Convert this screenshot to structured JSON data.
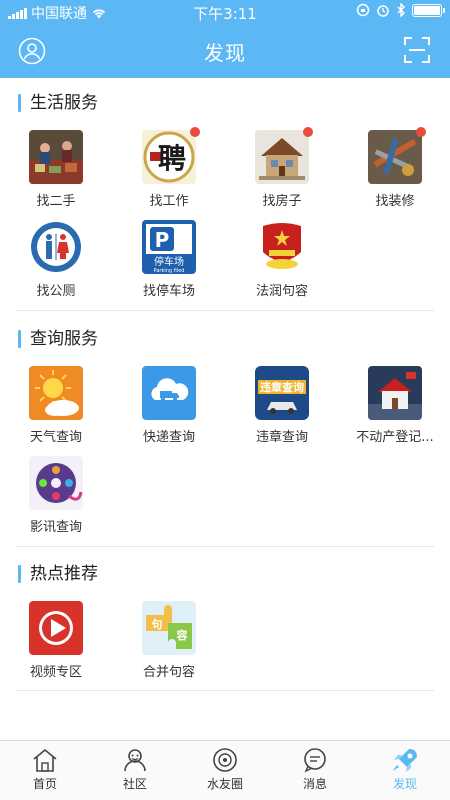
{
  "status_bar": {
    "carrier": "中国联通",
    "time": "下午3:11"
  },
  "nav": {
    "title": "发现"
  },
  "sections": [
    {
      "title": "生活服务",
      "items": [
        {
          "label": "找二手",
          "badge": false
        },
        {
          "label": "找工作",
          "badge": true
        },
        {
          "label": "找房子",
          "badge": true
        },
        {
          "label": "找装修",
          "badge": true
        },
        {
          "label": "找公厕",
          "badge": false
        },
        {
          "label": "找停车场",
          "badge": false
        },
        {
          "label": "法润句容",
          "badge": false
        }
      ]
    },
    {
      "title": "查询服务",
      "items": [
        {
          "label": "天气查询"
        },
        {
          "label": "快递查询"
        },
        {
          "label": "违章查询"
        },
        {
          "label": "不动产登记..."
        },
        {
          "label": "影讯查询"
        }
      ]
    },
    {
      "title": "热点推荐",
      "items": [
        {
          "label": "视频专区"
        },
        {
          "label": "合并句容"
        }
      ]
    }
  ],
  "icon_text": {
    "job": "聘",
    "parking_sign": "停车场",
    "parking_sub": "Parking filed",
    "violation": "违章查询",
    "jurong_a": "句",
    "jurong_b": "容"
  },
  "tabbar": {
    "tabs": [
      {
        "label": "首页",
        "icon": "home-icon",
        "active": false
      },
      {
        "label": "社区",
        "icon": "community-icon",
        "active": false
      },
      {
        "label": "水友圈",
        "icon": "circle-icon",
        "active": false
      },
      {
        "label": "消息",
        "icon": "message-icon",
        "active": false
      },
      {
        "label": "发现",
        "icon": "rocket-icon",
        "active": true
      }
    ]
  },
  "colors": {
    "accent": "#5bb8f5",
    "badge": "#e84c3d"
  }
}
